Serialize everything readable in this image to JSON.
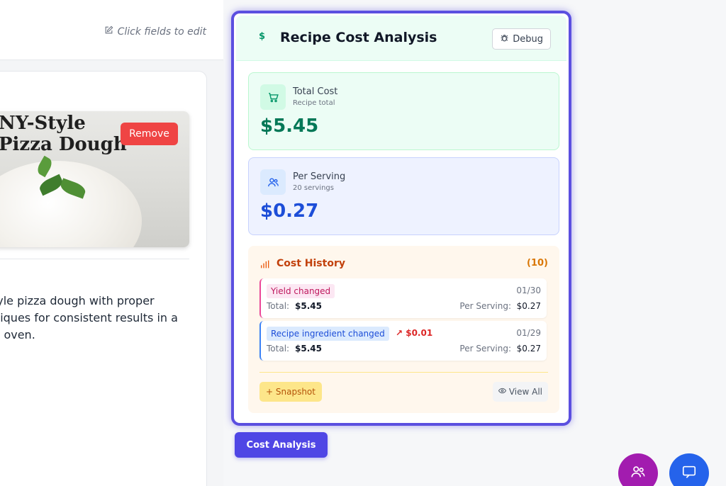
{
  "background": {
    "hint": "Click fields to edit",
    "recipe_image_title": "NY-Style\nPizza Dough",
    "remove_label": "Remove",
    "description": "NY-style pizza dough with proper\ntechniques for consistent results in a\nhome oven."
  },
  "panel": {
    "title": "Recipe Cost Analysis",
    "debug_label": "Debug",
    "total": {
      "label": "Total Cost",
      "sub": "Recipe total",
      "value": "$5.45"
    },
    "serving": {
      "label": "Per Serving",
      "sub": "20 servings",
      "value": "$0.27"
    },
    "history": {
      "title": "Cost History",
      "count": "(10)",
      "entries": [
        {
          "badge": "Yield changed",
          "change": "",
          "date": "01/30",
          "total_label": "Total:",
          "total_value": "$5.45",
          "ps_label": "Per Serving:",
          "ps_value": "$0.27"
        },
        {
          "badge": "Recipe ingredient changed",
          "change": "↗ $0.01",
          "date": "01/29",
          "total_label": "Total:",
          "total_value": "$5.45",
          "ps_label": "Per Serving:",
          "ps_value": "$0.27"
        }
      ],
      "snapshot_label": "+ Snapshot",
      "view_all_label": "View All"
    }
  },
  "cost_tab_label": "Cost Analysis",
  "icons": [
    "edit-icon",
    "dollar-icon",
    "bug-icon",
    "cart-icon",
    "users-icon",
    "bar-chart-icon",
    "eye-icon",
    "chat-icon"
  ],
  "colors": {
    "accent": "#4f46e5",
    "total": "#047857",
    "serving": "#1d4ed8",
    "history": "#c2410c",
    "remove": "#ef4444"
  }
}
